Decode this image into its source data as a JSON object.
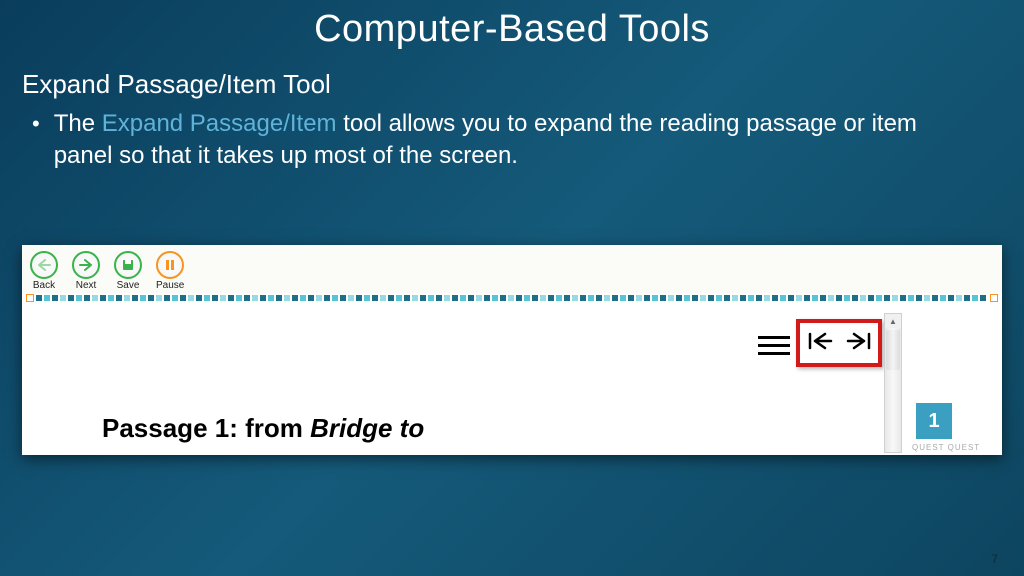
{
  "slide": {
    "title": "Computer-Based Tools",
    "subtitle": "Expand Passage/Item Tool",
    "bullet_pre": "The ",
    "bullet_accent": "Expand Passage/Item",
    "bullet_post": " tool allows you to expand the reading passage or item panel so that it takes up most of the screen.",
    "page_number": "7"
  },
  "toolbar": {
    "back": "Back",
    "next": "Next",
    "save": "Save",
    "pause": "Pause"
  },
  "passage": {
    "label_pre": "Passage 1: from ",
    "label_italic": "Bridge to"
  },
  "question": {
    "number": "1",
    "tabs": "QUEST   QUEST"
  },
  "icons": {
    "hamburger": "menu-icon",
    "collapse_left": "collapse-left-icon",
    "expand_right": "expand-right-icon"
  }
}
